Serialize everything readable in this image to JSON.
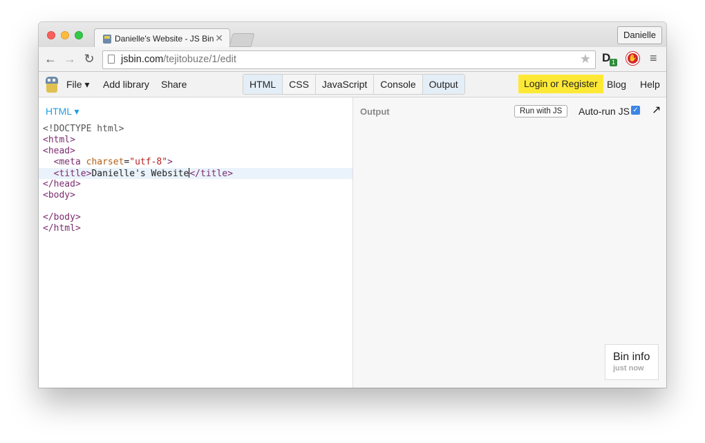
{
  "browser": {
    "tab": {
      "title": "Danielle's Website - JS Bin",
      "close_glyph": "✕"
    },
    "profile_name": "Danielle",
    "url": {
      "domain": "jsbin.com",
      "path": "/tejitobuze/1/edit"
    },
    "nav": {
      "back": "←",
      "forward": "→",
      "reload": "↻"
    },
    "star": "★",
    "ext_d": {
      "letter": "D",
      "badge": "1"
    },
    "menu_glyph": "≡"
  },
  "jsbin": {
    "menu": {
      "file": "File ▾",
      "add_library": "Add library",
      "share": "Share"
    },
    "panels": [
      "HTML",
      "CSS",
      "JavaScript",
      "Console",
      "Output"
    ],
    "active_panels": [
      "HTML",
      "Output"
    ],
    "login": "Login or Register",
    "blog": "Blog",
    "help": "Help",
    "editor": {
      "language": "HTML ▾",
      "code": {
        "doctype": "<!DOCTYPE html>",
        "html_open": "<html>",
        "head_open": "<head>",
        "meta_open": "  <meta ",
        "meta_attr": "charset",
        "meta_eq": "=",
        "meta_val": "\"utf-8\"",
        "meta_close": ">",
        "title_open": "  <title>",
        "title_text": "Danielle's Website",
        "title_close": "</title>",
        "head_close": "</head>",
        "body_open": "<body>",
        "body_close": "</body>",
        "html_close": "</html>"
      }
    },
    "output": {
      "label": "Output",
      "run_with_js": "Run with JS",
      "auto_run": "Auto-run JS",
      "auto_run_checked": "✓",
      "popout": "↗",
      "bin_info_title": "Bin info",
      "bin_info_time": "just now"
    }
  },
  "colors": {
    "accent": "#1e9de3",
    "login_bg": "#fde935",
    "active_panel": "#e4eef7"
  }
}
